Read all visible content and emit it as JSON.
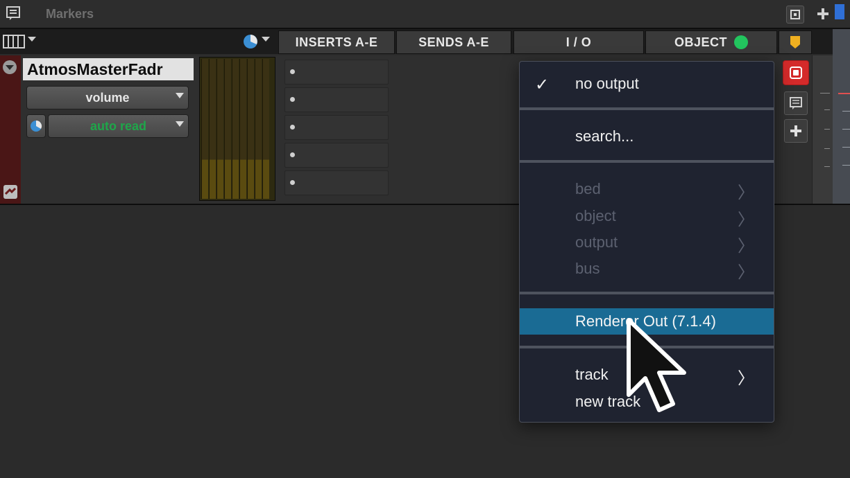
{
  "markers": {
    "title": "Markers"
  },
  "columns": {
    "inserts": "INSERTS A-E",
    "sends": "SENDS A-E",
    "io": "I / O",
    "object": "OBJECT"
  },
  "track": {
    "name": "AtmosMasterFadr",
    "volume_label": "volume",
    "automation_label": "auto read"
  },
  "menu": {
    "checkmark": "✓",
    "items": [
      {
        "label": "no output",
        "checked": true,
        "enabled": true
      },
      {
        "label": "search...",
        "enabled": true
      },
      {
        "label": "bed",
        "enabled": false,
        "submenu": true
      },
      {
        "label": "object",
        "enabled": false,
        "submenu": true
      },
      {
        "label": "output",
        "enabled": false,
        "submenu": true
      },
      {
        "label": "bus",
        "enabled": false,
        "submenu": true
      },
      {
        "label": "Renderer Out (7.1.4)",
        "enabled": true,
        "highlighted": true
      },
      {
        "label": "track",
        "enabled": true,
        "submenu": true
      },
      {
        "label": "new track",
        "enabled": true
      }
    ],
    "chevron": "〉"
  },
  "colors": {
    "object_indicator": "#22c55e",
    "automation_text": "#1fa64a",
    "highlight": "#1a6b94",
    "track_strip": "#4a1616"
  }
}
